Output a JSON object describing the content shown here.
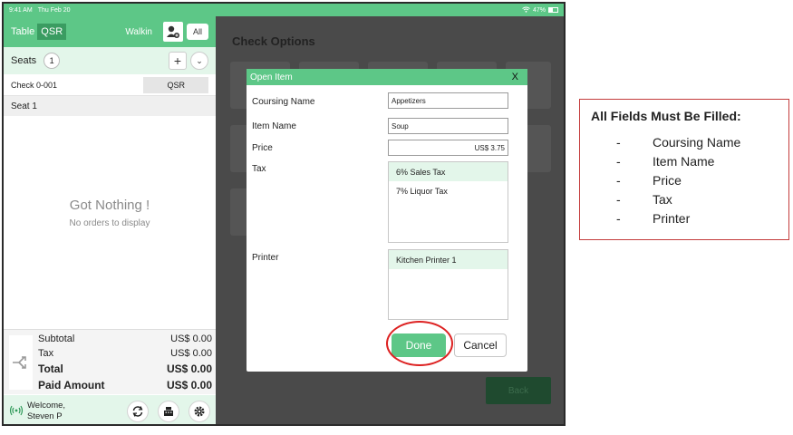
{
  "status_bar": {
    "time": "9:41 AM",
    "date": "Thu Feb 20",
    "battery": "47%"
  },
  "left_panel": {
    "header": {
      "table_label": "Table",
      "mode_label": "QSR",
      "walkin_label": "Walkin",
      "all_label": "All"
    },
    "seats": {
      "label": "Seats",
      "count": "1",
      "plus": "+",
      "chevron": "⌄"
    },
    "check": {
      "label": "Check",
      "number": "0-001",
      "type": "QSR"
    },
    "seat_label": "Seat 1",
    "empty": {
      "title": "Got Nothing !",
      "subtitle": "No orders to display"
    },
    "totals": {
      "subtotal_label": "Subtotal",
      "subtotal": "US$ 0.00",
      "tax_label": "Tax",
      "tax": "US$ 0.00",
      "total_label": "Total",
      "total": "US$ 0.00",
      "paid_label": "Paid Amount",
      "paid": "US$ 0.00"
    },
    "footer": {
      "welcome_line1": "Welcome,",
      "welcome_line2": "Steven P"
    }
  },
  "check_options": {
    "title": "Check Options",
    "back_label": "Back"
  },
  "modal": {
    "title": "Open Item",
    "close": "X",
    "coursing_label": "Coursing Name",
    "coursing_value": "Appetizers",
    "item_label": "Item Name",
    "item_value": "Soup",
    "price_label": "Price",
    "price_value": "US$ 3.75",
    "tax_label": "Tax",
    "tax_options": [
      "6% Sales Tax",
      "7% Liquor Tax"
    ],
    "printer_label": "Printer",
    "printer_options": [
      "Kitchen Printer 1"
    ],
    "done_label": "Done",
    "cancel_label": "Cancel"
  },
  "annotation": {
    "title": "All Fields Must Be Filled:",
    "dash": "-",
    "items": [
      "Coursing Name",
      "Item Name",
      "Price",
      "Tax",
      "Printer"
    ]
  },
  "colors": {
    "primary_green": "#5dc787",
    "dark_green": "#3a9c61",
    "highlight": "#e3f6ea",
    "annotation_red": "#d22222"
  }
}
